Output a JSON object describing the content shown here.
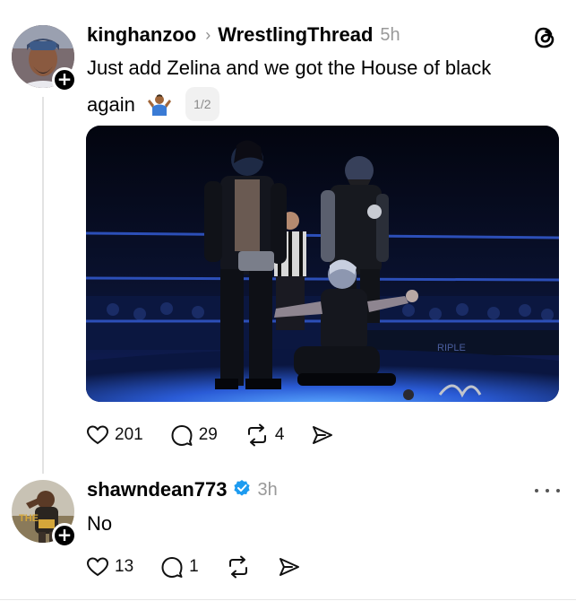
{
  "post": {
    "username": "kinghanzoo",
    "community": "WrestlingThread",
    "time": "5h",
    "text_line1": "Just add Zelina and we got the House of black",
    "text_line2": "again",
    "page_badge": "1/2",
    "likes": "201",
    "replies": "29",
    "reposts": "4",
    "image_ring_text": "RIPLE"
  },
  "reply": {
    "username": "shawndean773",
    "time": "3h",
    "text": "No",
    "likes": "13",
    "replies": "1",
    "avatar_shirt_text": "THE"
  },
  "colors": {
    "verified": "#1d9bf0",
    "ring_light": "#2a5bd6",
    "muted": "#999999"
  }
}
